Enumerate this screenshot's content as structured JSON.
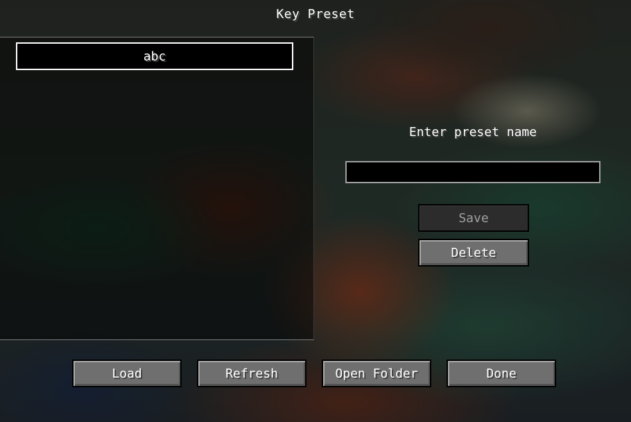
{
  "screen": {
    "title": "Key Preset"
  },
  "preset_list": {
    "items": [
      "abc"
    ]
  },
  "editor": {
    "prompt": "Enter preset name",
    "name_value": "",
    "save_label": "Save",
    "delete_label": "Delete"
  },
  "footer": {
    "load_label": "Load",
    "refresh_label": "Refresh",
    "open_folder_label": "Open Folder",
    "done_label": "Done"
  }
}
